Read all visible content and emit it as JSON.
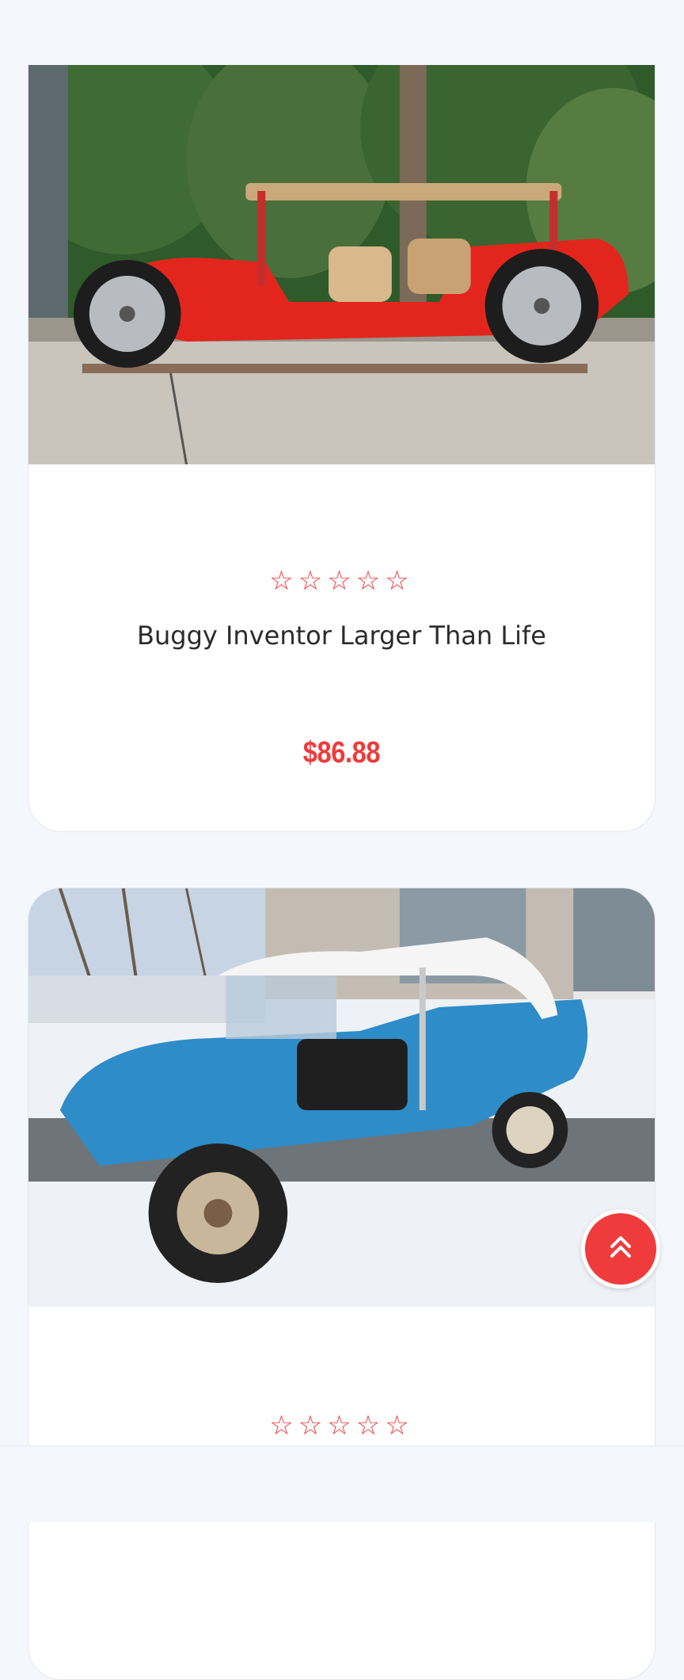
{
  "products": [
    {
      "image_alt": "red-dune-buggy-photo",
      "rating_stars": "☆☆☆☆☆",
      "title": "Buggy Inventor Larger Than Life",
      "price": "$86.88"
    },
    {
      "image_alt": "blue-dune-buggy-photo",
      "rating_stars": "☆☆☆☆☆"
    }
  ],
  "scroll_top": {
    "icon": "double-chevron-up-icon"
  },
  "colors": {
    "accent": "#ef3b3b",
    "background": "#f4f7fc",
    "card": "#ffffff"
  }
}
